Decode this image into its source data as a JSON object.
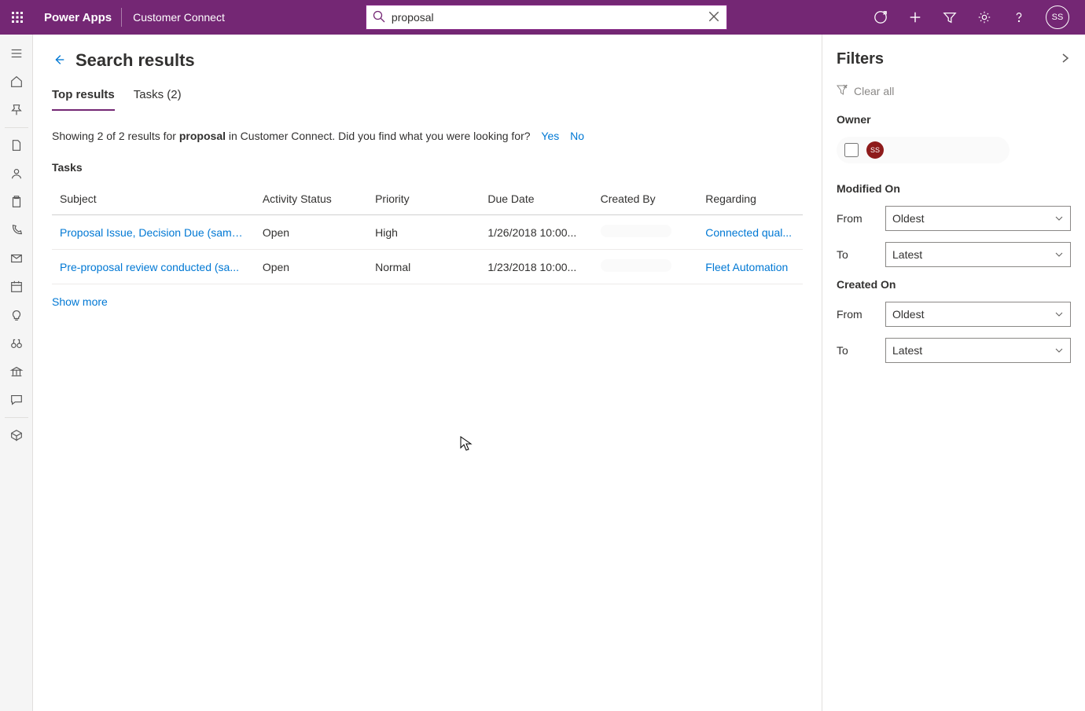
{
  "header": {
    "app_name": "Power Apps",
    "env_name": "Customer Connect",
    "search_value": "proposal",
    "avatar_initials": "SS"
  },
  "page": {
    "title": "Search results",
    "tabs": [
      {
        "label": "Top results",
        "active": true
      },
      {
        "label": "Tasks (2)",
        "active": false
      }
    ],
    "summary_prefix": "Showing 2 of 2 results for ",
    "summary_term": "proposal",
    "summary_suffix": " in Customer Connect. Did you find what you were looking for?",
    "yes": "Yes",
    "no": "No",
    "section_label": "Tasks",
    "columns": [
      "Subject",
      "Activity Status",
      "Priority",
      "Due Date",
      "Created By",
      "Regarding"
    ],
    "rows": [
      {
        "subject": "Proposal Issue, Decision Due (sampl...",
        "status": "Open",
        "priority": "High",
        "due": "1/26/2018 10:00...",
        "regarding": "Connected qual..."
      },
      {
        "subject": "Pre-proposal review conducted (sa...",
        "status": "Open",
        "priority": "Normal",
        "due": "1/23/2018 10:00...",
        "regarding": "Fleet Automation"
      }
    ],
    "show_more": "Show more"
  },
  "filters": {
    "title": "Filters",
    "clear_all": "Clear all",
    "owner_label": "Owner",
    "owner_initials": "SS",
    "modified_label": "Modified On",
    "created_label": "Created On",
    "from_label": "From",
    "to_label": "To",
    "oldest": "Oldest",
    "latest": "Latest"
  }
}
